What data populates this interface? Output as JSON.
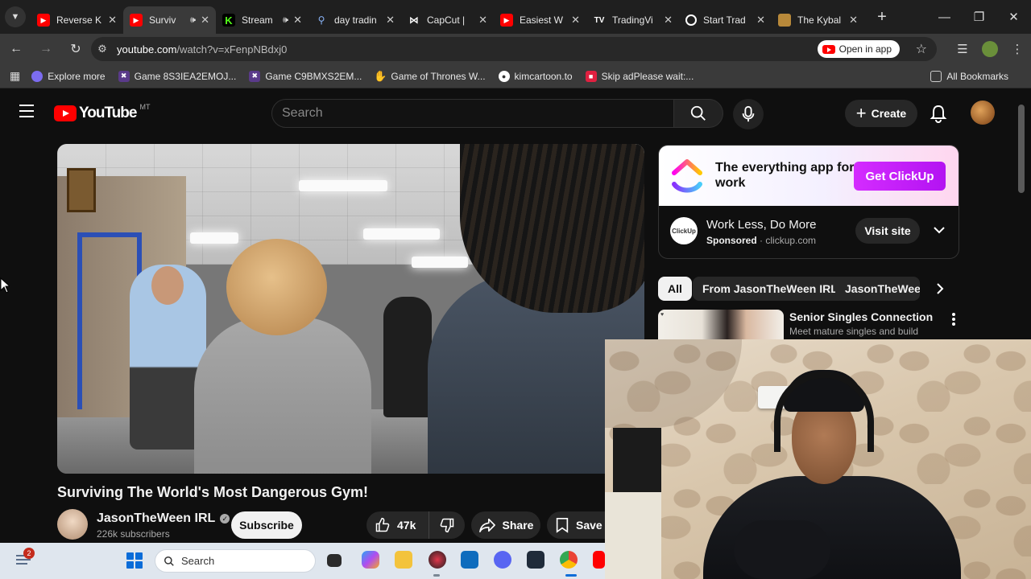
{
  "browser": {
    "tabs": [
      {
        "title": "Reverse K",
        "favicon": "youtube-icon",
        "active": false,
        "audio": false
      },
      {
        "title": "Surviv",
        "favicon": "youtube-icon",
        "active": true,
        "audio": true
      },
      {
        "title": "Stream",
        "favicon": "kick-icon",
        "active": false,
        "audio": true
      },
      {
        "title": "day tradin",
        "favicon": "search-icon",
        "active": false,
        "audio": false
      },
      {
        "title": "CapCut | ",
        "favicon": "capcut-icon",
        "active": false,
        "audio": false
      },
      {
        "title": "Easiest W",
        "favicon": "youtube-icon",
        "active": false,
        "audio": false
      },
      {
        "title": "TradingVi",
        "favicon": "tradingview-icon",
        "active": false,
        "audio": false
      },
      {
        "title": "Start Trad",
        "favicon": "site-icon",
        "active": false,
        "audio": false
      },
      {
        "title": "The Kybal",
        "favicon": "site-icon",
        "active": false,
        "audio": false
      }
    ],
    "url_host": "youtube.com",
    "url_path": "/watch?v=xFenpNBdxj0",
    "open_in_app_label": "Open in app",
    "bookmarks": [
      {
        "label": "Explore more"
      },
      {
        "label": "Game 8S3IEA2EMOJ..."
      },
      {
        "label": "Game C9BMXS2EM..."
      },
      {
        "label": "Game of Thrones W..."
      },
      {
        "label": "kimcartoon.to"
      },
      {
        "label": "Skip adPlease wait:..."
      }
    ],
    "all_bookmarks_label": "All Bookmarks"
  },
  "youtube": {
    "logo_text": "YouTube",
    "country_code": "MT",
    "search_placeholder": "Search",
    "create_label": "Create",
    "video": {
      "title": "Surviving The World's Most Dangerous Gym!",
      "channel": "JasonTheWeen IRL",
      "subscribers": "226k subscribers",
      "subscribe_label": "Subscribe",
      "likes": "47k",
      "share_label": "Share",
      "save_label": "Save"
    },
    "ad": {
      "headline": "The everything app for work",
      "cta": "Get ClickUp",
      "advertiser_logo_text": "ClickUp",
      "title": "Work Less, Do More",
      "sponsored_label": "Sponsored",
      "domain": "clickup.com",
      "visit_label": "Visit site"
    },
    "chips": [
      "All",
      "From JasonTheWeen IRL",
      "JasonTheWeen"
    ],
    "recommendation": {
      "title": "Senior Singles Connection",
      "description": "Meet mature singles and build"
    }
  },
  "taskbar": {
    "notification_count": "2",
    "search_placeholder": "Search"
  }
}
